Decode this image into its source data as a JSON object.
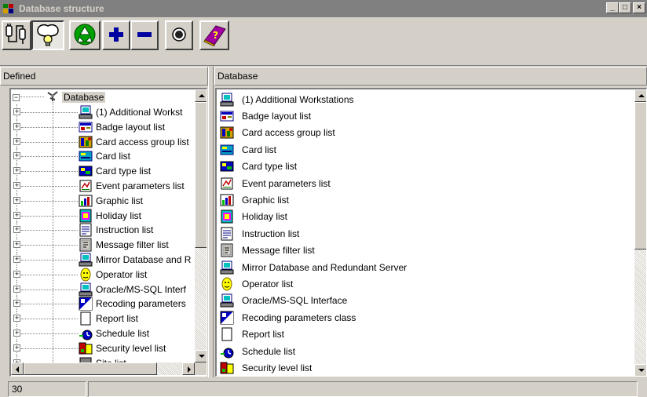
{
  "window": {
    "title": "Database structure",
    "buttons": {
      "minimize": "_",
      "maximize": "□",
      "close": "×"
    }
  },
  "toolbar": {
    "buttons": [
      {
        "name": "connect-icon"
      },
      {
        "name": "lightbulb-icon"
      },
      {
        "name": "recycle-icon"
      },
      {
        "name": "plus-icon"
      },
      {
        "name": "minus-icon"
      },
      {
        "name": "record-icon"
      },
      {
        "name": "help-book-icon"
      }
    ]
  },
  "left_panel": {
    "header": "Defined",
    "root_label": "Database",
    "items": [
      {
        "label": "(1) Additional Workst",
        "icon": "workstation-icon"
      },
      {
        "label": "Badge layout list",
        "icon": "badge-icon"
      },
      {
        "label": "Card access group list",
        "icon": "access-group-icon"
      },
      {
        "label": "Card list",
        "icon": "card-icon"
      },
      {
        "label": "Card type list",
        "icon": "card-type-icon"
      },
      {
        "label": "Event parameters list",
        "icon": "event-icon"
      },
      {
        "label": "Graphic list",
        "icon": "graphic-icon"
      },
      {
        "label": "Holiday list",
        "icon": "holiday-icon"
      },
      {
        "label": "Instruction list",
        "icon": "instruction-icon"
      },
      {
        "label": "Message filter list",
        "icon": "message-filter-icon"
      },
      {
        "label": "Mirror Database and R",
        "icon": "mirror-db-icon"
      },
      {
        "label": "Operator list",
        "icon": "operator-icon"
      },
      {
        "label": "Oracle/MS-SQL Interf",
        "icon": "oracle-icon"
      },
      {
        "label": "Recoding parameters",
        "icon": "recoding-icon"
      },
      {
        "label": "Report list",
        "icon": "report-icon"
      },
      {
        "label": "Schedule list",
        "icon": "schedule-icon"
      },
      {
        "label": "Security level list",
        "icon": "security-icon"
      },
      {
        "label": "Site list",
        "icon": "site-icon"
      }
    ]
  },
  "right_panel": {
    "header": "Database",
    "items": [
      {
        "label": "(1) Additional Workstations",
        "icon": "workstation-icon"
      },
      {
        "label": "Badge layout list",
        "icon": "badge-icon"
      },
      {
        "label": "Card access group list",
        "icon": "access-group-icon"
      },
      {
        "label": "Card list",
        "icon": "card-icon"
      },
      {
        "label": "Card type list",
        "icon": "card-type-icon"
      },
      {
        "label": "Event parameters list",
        "icon": "event-icon"
      },
      {
        "label": "Graphic list",
        "icon": "graphic-icon"
      },
      {
        "label": "Holiday list",
        "icon": "holiday-icon"
      },
      {
        "label": "Instruction list",
        "icon": "instruction-icon"
      },
      {
        "label": "Message filter list",
        "icon": "message-filter-icon"
      },
      {
        "label": "Mirror Database and Redundant Server",
        "icon": "mirror-db-icon"
      },
      {
        "label": "Operator list",
        "icon": "operator-icon"
      },
      {
        "label": "Oracle/MS-SQL Interface",
        "icon": "oracle-icon"
      },
      {
        "label": "Recoding parameters class",
        "icon": "recoding-icon"
      },
      {
        "label": "Report list",
        "icon": "report-icon"
      },
      {
        "label": "Schedule list",
        "icon": "schedule-icon"
      },
      {
        "label": "Security level list",
        "icon": "security-icon"
      }
    ]
  },
  "statusbar": {
    "count": "30",
    "message": ""
  },
  "colors": {
    "titlebar_inactive": "#808080",
    "window_face": "#d4d0c8",
    "tree_selection": "#d4d0c8"
  }
}
